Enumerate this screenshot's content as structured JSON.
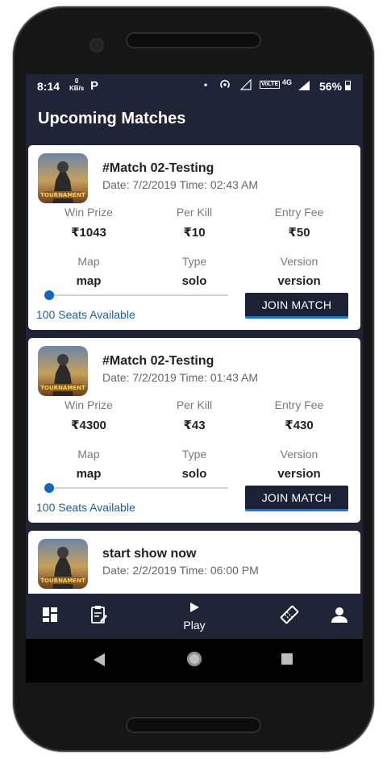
{
  "status_bar": {
    "time": "8:14",
    "kbs_value": "0",
    "kbs_unit": "KB/s",
    "p_label": "P",
    "volte": "VoLTE",
    "network": "4G",
    "battery": "56%"
  },
  "app_bar": {
    "title": "Upcoming Matches"
  },
  "labels": {
    "win_prize": "Win Prize",
    "per_kill": "Per Kill",
    "entry_fee": "Entry Fee",
    "map": "Map",
    "type": "Type",
    "version": "Version",
    "join_button": "JOIN MATCH"
  },
  "matches": [
    {
      "title": "#Match 02-Testing",
      "date_time": "Date: 7/2/2019  Time: 02:43 AM",
      "win_prize": "₹1043",
      "per_kill": "₹10",
      "entry_fee": "₹50",
      "map": "map",
      "type": "solo",
      "version": "version",
      "seats": "100 Seats Available",
      "seats_filled_fraction": 0.0
    },
    {
      "title": "#Match 02-Testing",
      "date_time": "Date: 7/2/2019  Time: 01:43 AM",
      "win_prize": "₹4300",
      "per_kill": "₹43",
      "entry_fee": "₹430",
      "map": "map",
      "type": "solo",
      "version": "version",
      "seats": "100 Seats Available",
      "seats_filled_fraction": 0.0
    },
    {
      "title": "start show now",
      "date_time": "Date: 2/2/2019  Time: 06:00 PM"
    }
  ],
  "bottom_nav": {
    "items": [
      {
        "icon": "dashboard-icon"
      },
      {
        "icon": "clipboard-icon"
      },
      {
        "icon": "play-icon",
        "label": "Play"
      },
      {
        "icon": "ticket-icon"
      },
      {
        "icon": "profile-icon"
      }
    ]
  },
  "colors": {
    "app_background": "#1f2437",
    "card_background": "#ffffff",
    "accent_blue": "#1565c0",
    "seats_text": "#1e5fa0"
  }
}
